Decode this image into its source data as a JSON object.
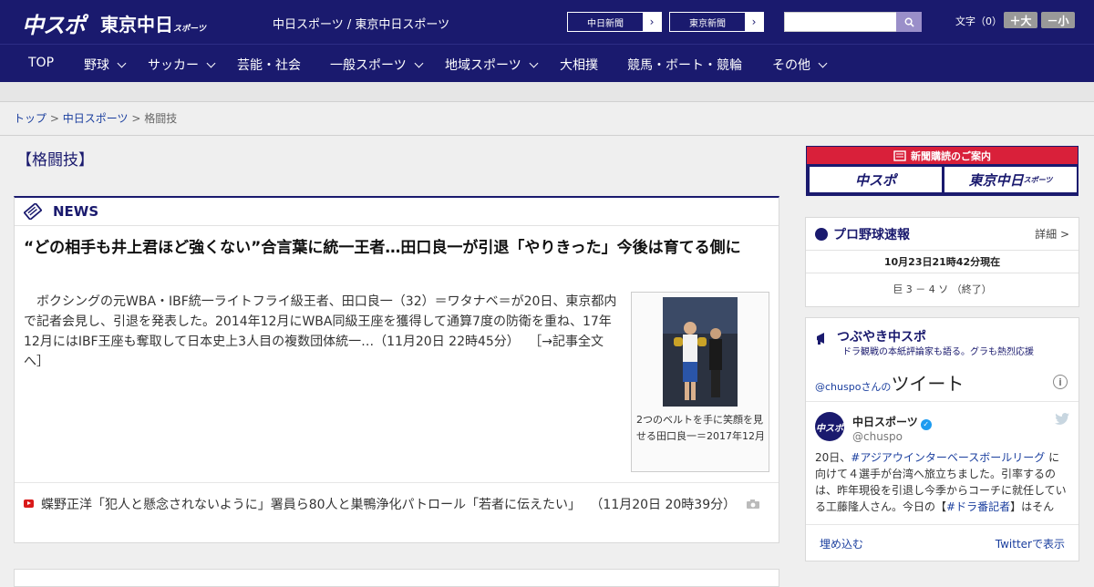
{
  "header": {
    "logo": "中スポ",
    "logo2": "東京中日",
    "logo2_small": "スポーツ",
    "site_names": "中日スポーツ / 東京中日スポーツ",
    "ext_links": [
      "中日新聞",
      "東京新聞"
    ],
    "search_placeholder": "",
    "fontsize_label": "文字（0）",
    "font_larger": "＋大",
    "font_smaller": "－小"
  },
  "nav": [
    "TOP",
    "野球",
    "サッカー",
    "芸能・社会",
    "一般スポーツ",
    "地域スポーツ",
    "大相撲",
    "競馬・ボート・競輪",
    "その他"
  ],
  "breadcrumb": {
    "top": "トップ",
    "sep": ">",
    "site": "中日スポーツ",
    "current": "格闘技"
  },
  "page_title": "【格闘技】",
  "news": {
    "label": "NEWS",
    "headline": "“どの相手も井上君ほど強くない”合言葉に統一王者…田口良一が引退「やりきった」今後は育てる側に",
    "summary": "　ボクシングの元WBA・IBF統一ライトフライ級王者、田口良一（32）＝ワタナベ＝が20日、東京都内で記者会見し、引退を発表した。2014年12月にWBA同級王座を獲得して通算7度の防衛を重ね、17年12月にはIBF王座も奪取して日本史上3人目の複数団体統一…（11月20日 22時45分）",
    "read_more": "［→記事全文へ］",
    "caption": "2つのベルトを手に笑顔を見せる田口良一＝2017年12月",
    "sub_headline": "蝶野正洋「犯人と懸念されないように」署員ら80人と巣鴨浄化パトロール「若者に伝えたい」",
    "sub_time": "（11月20日 20時39分）"
  },
  "sidebar": {
    "subscription_title": "新聞購読のご案内",
    "sub_buttons": [
      "中スポ",
      "東京中日"
    ],
    "sub_buttons_small": "スポーツ",
    "baseball": {
      "title": "プロ野球速報",
      "detail": "詳細 >",
      "timestamp": "10月23日21時42分現在",
      "score": "巨 3 － 4 ソ （終了）"
    },
    "twitter": {
      "title": "つぶやき中スポ",
      "subtitle": "ドラ観戦の本紙評論家も語る。グラも熱烈応援",
      "handle_prefix": "@chuspo",
      "handle_suffix": "さんの",
      "tweets_label": "ツイート",
      "avatar_text": "中スポ",
      "name": "中日スポーツ",
      "handle": "@chuspo",
      "text_1": "20日、",
      "hash_1": "#アジアウインターベースボールリーグ",
      "text_2": " に向けて４選手が台湾へ旅立ちました。引率するのは、昨年現役を引退し今季からコーチに就任している工藤隆人さん。今日の【",
      "hash_2": "#ドラ番記者",
      "text_3": "】はそんな“新米",
      "embed": "埋め込む",
      "view_on": "Twitterで表示"
    }
  }
}
